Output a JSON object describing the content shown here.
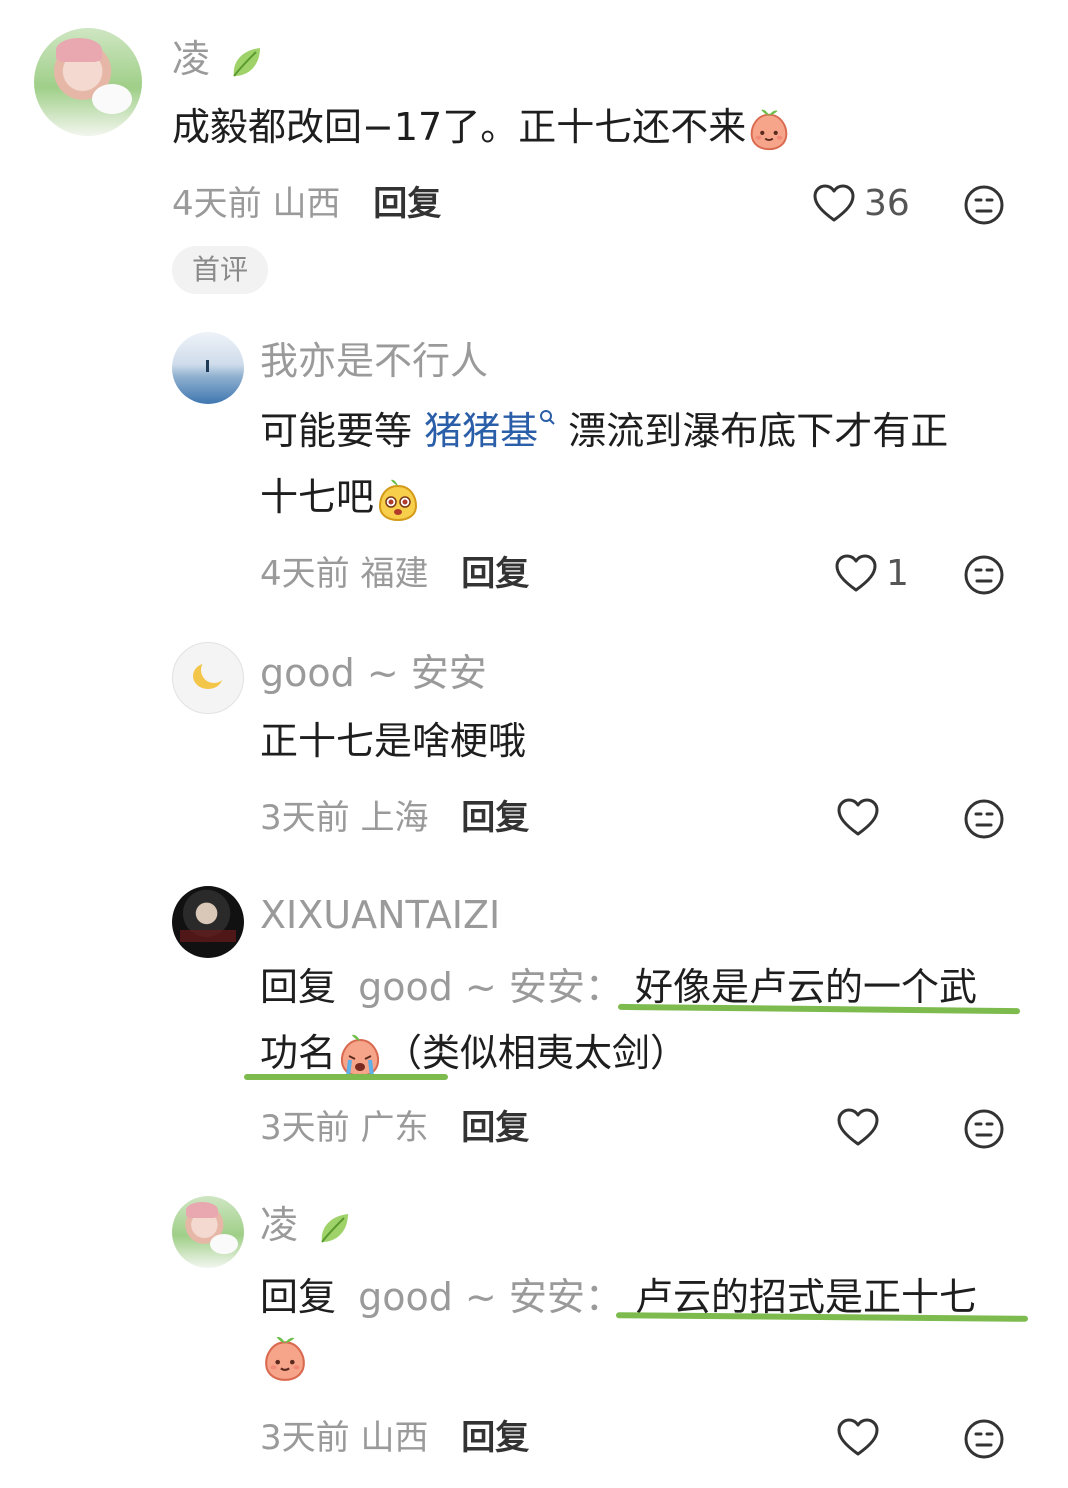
{
  "comments": [
    {
      "user": "凌",
      "text": "成毅都改回−17了。正十七还不来",
      "time": "4天前",
      "location": "山西",
      "reply_label": "回复",
      "likes": "36",
      "badge": "首评"
    },
    {
      "user": "我亦是不行人",
      "text_before": "可能要等",
      "mention": "猪猪基",
      "text_after": "漂流到瀑布底下才有正",
      "text_line2": "十七吧",
      "time": "4天前",
      "location": "福建",
      "reply_label": "回复",
      "likes": "1"
    },
    {
      "user": "good ~ 安安",
      "text": "正十七是啥梗哦",
      "time": "3天前",
      "location": "上海",
      "reply_label": "回复"
    },
    {
      "user": "XIXUANTAIZI",
      "reply_prefix": "回复",
      "reply_to": "good ~ 安安：",
      "text_line1": "好像是卢云的一个武",
      "text_line2a": "功名",
      "text_line2b": "（类似相夷太剑）",
      "time": "3天前",
      "location": "广东",
      "reply_label": "回复"
    },
    {
      "user": "凌",
      "reply_prefix": "回复",
      "reply_to": "good ~ 安安：",
      "text_line1": "卢云的招式是正十七",
      "time": "3天前",
      "location": "山西",
      "reply_label": "回复"
    }
  ],
  "icons": {
    "heart": "heart-outline-icon",
    "dislike": "neutral-face-icon",
    "leaf": "leaf-icon",
    "emoji_peach": "peach-face-emoji",
    "emoji_yellow": "yellow-face-emoji",
    "emoji_cry": "crying-face-emoji",
    "search": "search-icon"
  },
  "colors": {
    "mention": "#2b5ea8",
    "underline": "#7dbb4e",
    "meta": "#9a9a9a"
  }
}
